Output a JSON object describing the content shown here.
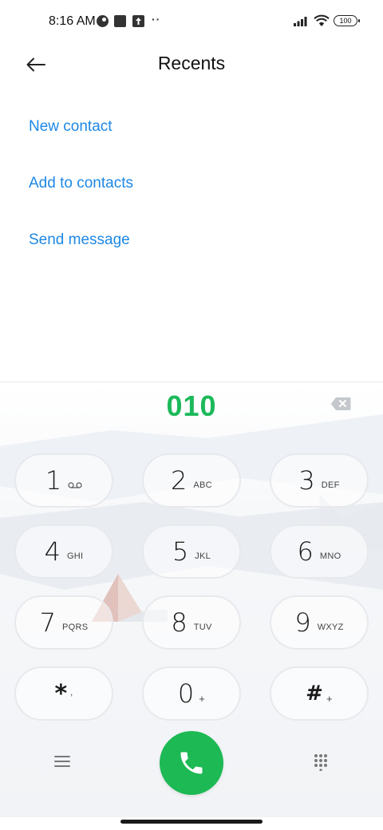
{
  "status_bar": {
    "time": "8:16 AM",
    "battery": "100",
    "icons": [
      "vpn-icon",
      "square-notification-icon",
      "upload-icon",
      "more-dots-icon",
      "signal-icon",
      "wifi-icon",
      "battery-icon"
    ]
  },
  "header": {
    "title": "Recents",
    "back_icon": "arrow-left-icon"
  },
  "actions": {
    "new_contact": "New contact",
    "add_to_contacts": "Add to contacts",
    "send_message": "Send message"
  },
  "dialer": {
    "number": "010",
    "keys": [
      {
        "digit": "1",
        "letters": ""
      },
      {
        "digit": "2",
        "letters": "ABC"
      },
      {
        "digit": "3",
        "letters": "DEF"
      },
      {
        "digit": "4",
        "letters": "GHI"
      },
      {
        "digit": "5",
        "letters": "JKL"
      },
      {
        "digit": "6",
        "letters": "MNO"
      },
      {
        "digit": "7",
        "letters": "PQRS"
      },
      {
        "digit": "8",
        "letters": "TUV"
      },
      {
        "digit": "9",
        "letters": "WXYZ"
      },
      {
        "digit": "*",
        "letters": ","
      },
      {
        "digit": "0",
        "letters": "+"
      },
      {
        "digit": "#",
        "letters": "+"
      }
    ]
  },
  "colors": {
    "accent_link": "#1e88e5",
    "dialed_number": "#1cb95a",
    "call_button": "#1db954"
  }
}
